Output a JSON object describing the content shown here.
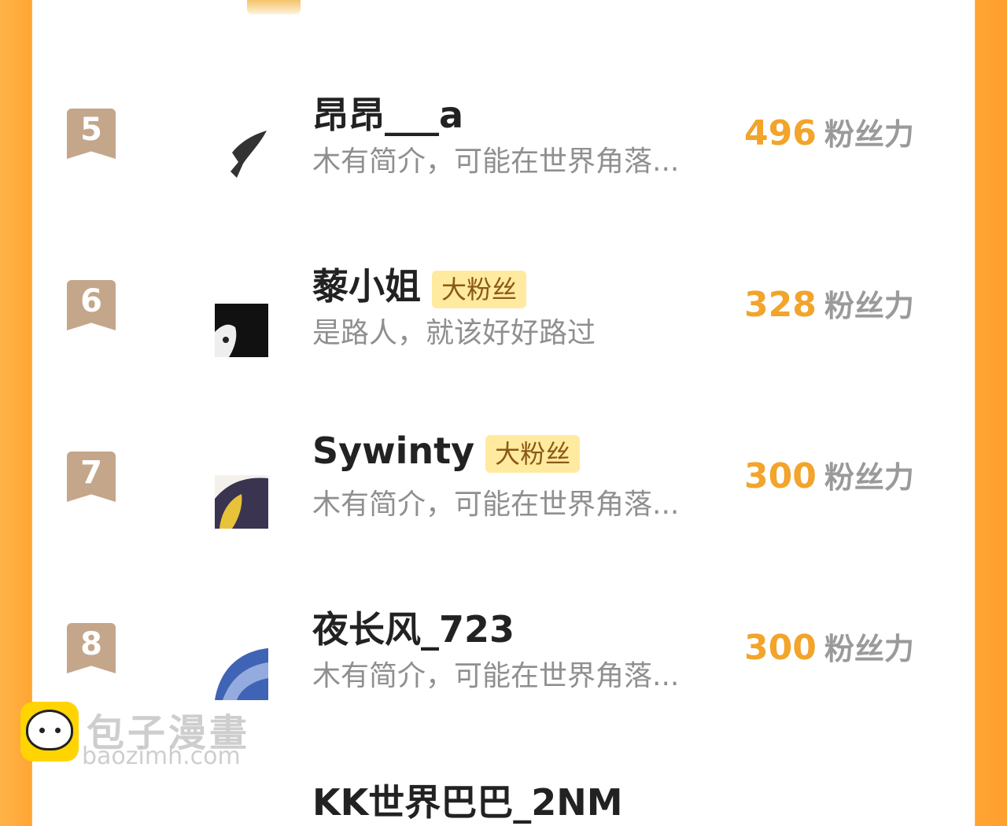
{
  "rows": [
    {
      "rank": "5",
      "name": "昂昂___a",
      "badge": "",
      "desc": "木有简介，可能在世界角落...",
      "score": "496",
      "unit": "粉丝力"
    },
    {
      "rank": "6",
      "name": "藜小姐",
      "badge": "大粉丝",
      "desc": "是路人，就该好好路过",
      "score": "328",
      "unit": "粉丝力"
    },
    {
      "rank": "7",
      "name": "Sywinty",
      "badge": "大粉丝",
      "desc": "木有简介，可能在世界角落...",
      "score": "300",
      "unit": "粉丝力"
    },
    {
      "rank": "8",
      "name": "夜长风_723",
      "badge": "",
      "desc": "木有简介，可能在世界角落...",
      "score": "300",
      "unit": "粉丝力"
    }
  ],
  "watermark": {
    "cn": "包子漫畫",
    "en": "baozimh.com"
  },
  "partial_next_name": "KK世界巴巴_2NM",
  "colors": {
    "accent_orange": "#f2a42b",
    "badge_bg": "#ffeaa0",
    "rank_bg": "#c4a68b"
  }
}
